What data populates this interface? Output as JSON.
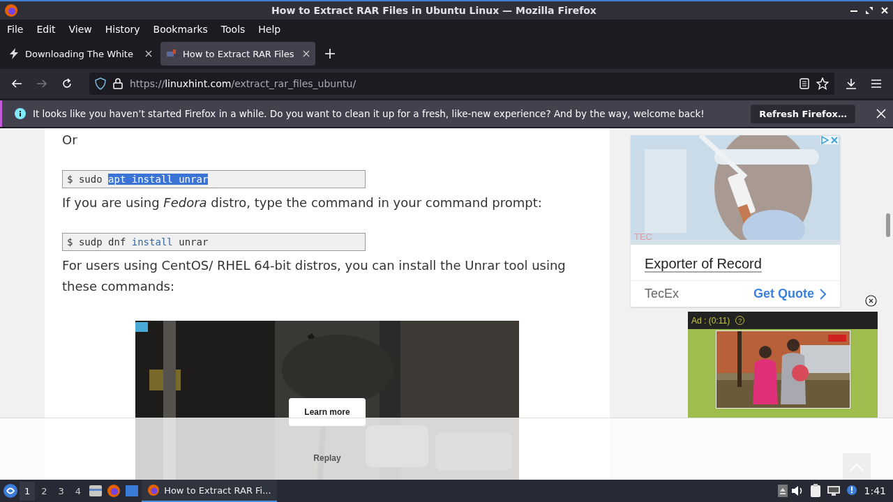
{
  "window": {
    "title": "How to Extract RAR Files in Ubuntu Linux — Mozilla Firefox"
  },
  "menu": [
    "File",
    "Edit",
    "View",
    "History",
    "Bookmarks",
    "Tools",
    "Help"
  ],
  "tabs": [
    {
      "title": "Downloading The White",
      "selected": false
    },
    {
      "title": "How to Extract RAR Files",
      "selected": true
    }
  ],
  "address": {
    "scheme": "https://",
    "domain": "linuxhint.com",
    "path": "/extract_rar_files_ubuntu/"
  },
  "notification": {
    "message": "It looks like you haven’t started Firefox in a while. Do you want to clean it up for a fresh, like-new experience? And by the way, welcome back!",
    "button": "Refresh Firefox…"
  },
  "article": [
    {
      "kind": "text",
      "text": "Or"
    },
    {
      "kind": "code",
      "segments": [
        {
          "kind": "prompt",
          "text": "$",
          "selected": false
        },
        {
          "kind": "plain",
          "text": "sudo",
          "selected": false
        },
        {
          "kind": "keyword",
          "text": "apt install unrar",
          "selected": true
        }
      ]
    },
    {
      "kind": "text",
      "text": "If you are using *Fedora* distro, type the command in your command prompt:"
    },
    {
      "kind": "code",
      "segments": [
        {
          "kind": "prompt",
          "text": "$",
          "selected": false
        },
        {
          "kind": "plain",
          "text": "sudp dnf",
          "selected": false
        },
        {
          "kind": "keyword",
          "text": "install",
          "selected": false
        },
        {
          "kind": "plain",
          "text": "unrar",
          "selected": false
        }
      ]
    },
    {
      "kind": "text",
      "text": "For users using CentOS/ RHEL 64-bit distros, you can install the Unrar tool using these commands:"
    }
  ],
  "video_ad": {
    "button": "Learn more",
    "replay": "Replay"
  },
  "side_ad": {
    "brand_mark": "TEC",
    "title": "Exporter of Record",
    "advertiser": "TecEx",
    "cta": "Get Quote"
  },
  "floating_ad": {
    "label": "Ad : (0:11)",
    "help": "?"
  },
  "taskbar": {
    "workspaces": [
      {
        "label": "1",
        "selected": true
      },
      {
        "label": "2",
        "selected": false
      },
      {
        "label": "3",
        "selected": false
      },
      {
        "label": "4",
        "selected": false
      }
    ],
    "task": {
      "title": "How to Extract RAR Fi...",
      "selected": true
    },
    "clock": "1:41"
  }
}
